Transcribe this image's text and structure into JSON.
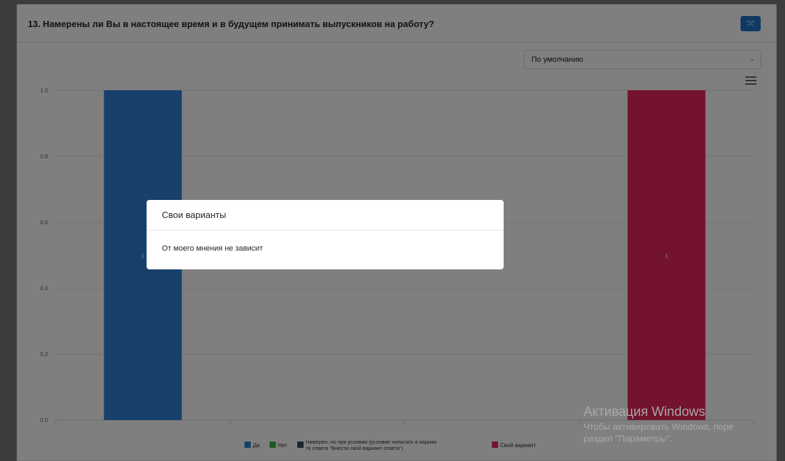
{
  "card": {
    "title": "13. Намерены ли Вы в настоящее время и в будущем принимать выпускников на работу?",
    "expand_icon": "⤧",
    "sort_select": {
      "value": "По умолчанию",
      "chevron": "⌄"
    }
  },
  "chart_data": {
    "type": "bar",
    "categories": [
      "Да",
      "Нет",
      "Намерен, но при условии (условие написать в варианте ответа \"Внести свой вариант ответа\")",
      "Свой вариант"
    ],
    "series": [
      {
        "name": "Да",
        "values": [
          1,
          null,
          null,
          null
        ]
      },
      {
        "name": "Нет",
        "values": [
          null,
          0,
          null,
          null
        ]
      },
      {
        "name": "Намерен, но при условии (условие написать в варианте ответа \"Внести свой вариант ответа\")",
        "values": [
          null,
          null,
          0,
          null
        ]
      },
      {
        "name": "Свой вариант",
        "values": [
          null,
          null,
          null,
          1
        ]
      }
    ],
    "ylim": [
      0,
      1
    ],
    "yticks": [
      "0.0",
      "0.2",
      "0.4",
      "0.6",
      "0.8",
      "1.0"
    ],
    "data_labels": [
      "1",
      "1"
    ],
    "colors": [
      "#2f80d6",
      "#3dbb3d",
      "#3c4a5a",
      "#e8265b"
    ],
    "legend": {
      "position": "bottom",
      "labels": [
        "Да",
        "Нет",
        "Намерен, но при условии (условие написать в варианте ответа \"Внести свой вариант ответа\")",
        "Свой вариант"
      ],
      "line1": "Намерен, но при условии (условие написать в вариан",
      "line2": "те ответа \"Внести свой вариант ответа\")"
    },
    "grid": true
  },
  "modal": {
    "title": "Свои варианты",
    "body": "От моего мнения не зависит"
  },
  "watermark": {
    "line1": "Активация Windows",
    "line2": "Чтобы активировать Windows, пере",
    "line3": "раздел \"Параметры\"."
  }
}
